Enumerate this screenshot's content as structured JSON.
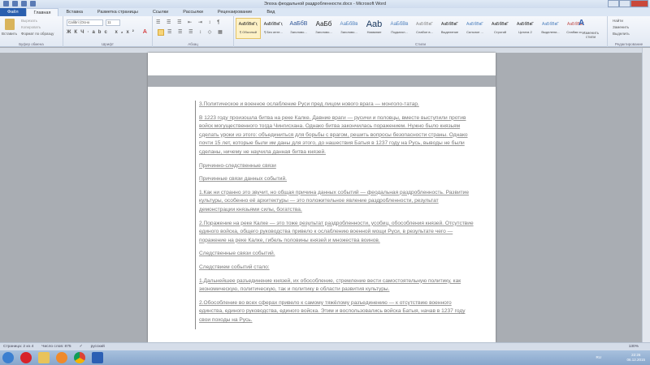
{
  "window": {
    "title": "Элоха феодальной раздробленности.docx - Microsoft Word"
  },
  "tabs": [
    "Файл",
    "Главная",
    "Вставка",
    "Разметка страницы",
    "Ссылки",
    "Рассылки",
    "Рецензирование",
    "Вид"
  ],
  "clipboard": {
    "paste": "Вставить",
    "cut": "Вырезать",
    "copy": "Копировать",
    "format": "Формат по образцу",
    "label": "Буфер обмена"
  },
  "font": {
    "name": "Calibri (Осно",
    "size": "11",
    "label": "Шрифт"
  },
  "paragraph": {
    "label": "Абзац"
  },
  "styles": {
    "label": "Стили",
    "items": [
      {
        "preview": "АаБбВвГг,",
        "name": "¶ Обычный"
      },
      {
        "preview": "АаБбВвГг,",
        "name": "¶ Без инте..."
      },
      {
        "preview": "АаБбВ",
        "name": "Заголово..."
      },
      {
        "preview": "АаБб",
        "name": "Заголово..."
      },
      {
        "preview": "АаБбВв",
        "name": "Заголово..."
      },
      {
        "preview": "Aab",
        "name": "Название"
      },
      {
        "preview": "АаБбВв",
        "name": "Подзагол..."
      },
      {
        "preview": "АаБбВвГ",
        "name": "Слабое в..."
      },
      {
        "preview": "АаБбВвГ",
        "name": "Выделение"
      },
      {
        "preview": "АаБбВвГ",
        "name": "Сильное ..."
      },
      {
        "preview": "АаБбВвГ",
        "name": "Строгий"
      },
      {
        "preview": "АаБбВвГ",
        "name": "Цитата 2"
      },
      {
        "preview": "АаБбВвГ",
        "name": "Выделени..."
      },
      {
        "preview": "АаБбВвГ",
        "name": "Слабая сс..."
      }
    ],
    "change": "Изменить стили"
  },
  "editing": {
    "find": "Найти",
    "replace": "Заменить",
    "select": "Выделить",
    "label": "Редактирование"
  },
  "document": {
    "paragraphs": [
      "3.Политическое и военное ослабление Руси пред лицом нового врага — монголо-татар.",
      "В 1223 году произошла битва на реке Калке. Давние враги — русичи и половцы, вместе выступили против войск могущественного тогда Чингисхана. Однако битва закончилась поражением. Нужно было князьям сделать уроки из этого: объединиться для борьбы с врагом, решить вопросы безопасности страны. Однако почти 15 лет, которые были им даны для этого, до нашествия Батыя в 1237 году на Русь, выводы не были сделаны, ничему не научила данная битва князей.",
      "Причинно-следственные связи",
      "Причинные связи данных событий.",
      "1.Как ни странно это звучит, но общая причина данных событий — феодальная раздробленность. Развитие культуры, особенно её архитектуры — это положительное явление раздробленности, результат демонстрации князьями силы, богатства.",
      "2.Поражение на реке Калке — это тоже результат раздробленности, усобиц, обособления князей. Отсутствие единого войска, общего руководства привело к ослаблению военной мощи Руси, в результате чего — поражение на реке Калке, гибель половины князей и множества воинов.",
      "Следственные связи событий.",
      "Следствием событий стало:",
      "1.Дальнейшее разъединение князей, их обособление, стремление вести самостоятельную политику, как экономическую, политическую, так и политику в области развития культуры.",
      "2.Обособление во всех сферах привело к самому тяжёлому разъединению — к отсутствию военного единства, единого руководства, единого войска. Этим и воспользовались войска Батыя, начав в 1237 году свои походы на Русь."
    ]
  },
  "status": {
    "page": "Страница: 2 из 4",
    "words": "Число слов: 875",
    "lang": "русский",
    "zoom": "130%"
  },
  "taskbar": {
    "lang": "RU",
    "time": "22:26",
    "date": "06.12.2015"
  }
}
